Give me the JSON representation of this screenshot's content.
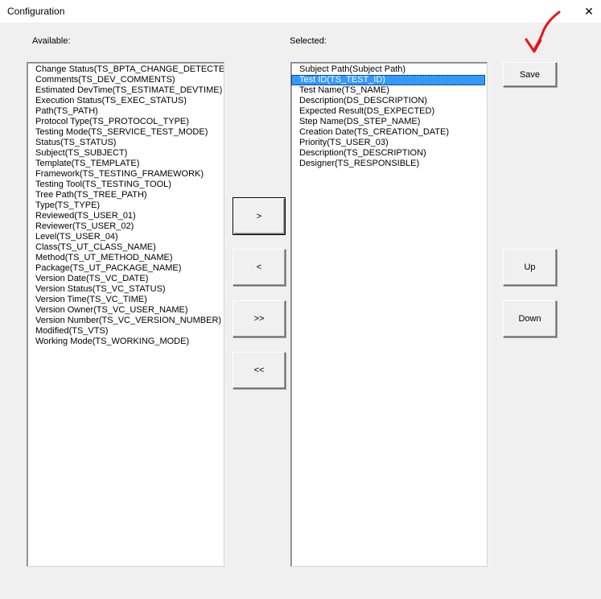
{
  "window": {
    "title": "Configuration",
    "close_glyph": "✕"
  },
  "available": {
    "label": "Available:",
    "items": [
      "Change Status(TS_BPTA_CHANGE_DETECTED)",
      "Comments(TS_DEV_COMMENTS)",
      "Estimated DevTime(TS_ESTIMATE_DEVTIME)",
      "Execution Status(TS_EXEC_STATUS)",
      "Path(TS_PATH)",
      "Protocol Type(TS_PROTOCOL_TYPE)",
      "Testing Mode(TS_SERVICE_TEST_MODE)",
      "Status(TS_STATUS)",
      "Subject(TS_SUBJECT)",
      "Template(TS_TEMPLATE)",
      "Framework(TS_TESTING_FRAMEWORK)",
      "Testing Tool(TS_TESTING_TOOL)",
      "Tree Path(TS_TREE_PATH)",
      "Type(TS_TYPE)",
      "Reviewed(TS_USER_01)",
      "Reviewer(TS_USER_02)",
      "Level(TS_USER_04)",
      "Class(TS_UT_CLASS_NAME)",
      "Method(TS_UT_METHOD_NAME)",
      "Package(TS_UT_PACKAGE_NAME)",
      "Version Date(TS_VC_DATE)",
      "Version Status(TS_VC_STATUS)",
      "Version Time(TS_VC_TIME)",
      "Version Owner(TS_VC_USER_NAME)",
      "Version Number(TS_VC_VERSION_NUMBER)",
      "Modified(TS_VTS)",
      "Working Mode(TS_WORKING_MODE)"
    ]
  },
  "selected": {
    "label": "Selected:",
    "selected_index": 1,
    "items": [
      "Subject Path(Subject Path)",
      "Test ID(TS_TEST_ID)",
      "Test Name(TS_NAME)",
      "Description(DS_DESCRIPTION)",
      "Expected Result(DS_EXPECTED)",
      "Step Name(DS_STEP_NAME)",
      "Creation Date(TS_CREATION_DATE)",
      "Priority(TS_USER_03)",
      "Description(TS_DESCRIPTION)",
      "Designer(TS_RESPONSIBLE)"
    ]
  },
  "buttons": {
    "add": ">",
    "remove": "<",
    "add_all": ">>",
    "remove_all": "<<",
    "save": "Save",
    "up": "Up",
    "down": "Down"
  },
  "colors": {
    "selection": "#3399ff",
    "annotation_arrow": "#e8141c"
  }
}
